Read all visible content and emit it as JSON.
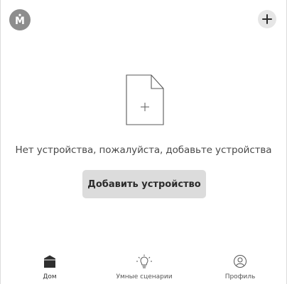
{
  "header": {
    "avatar_letter": "M",
    "avatar_icon": "user-avatar",
    "add_icon": "plus-icon"
  },
  "empty_state": {
    "icon": "file-plus-icon",
    "message": "Нет устройства, пожалуйста, добавьте устройства",
    "button_label": "Добавить устройство"
  },
  "bottom_nav": {
    "items": [
      {
        "label": "Дом",
        "icon": "home-icon",
        "active": true
      },
      {
        "label": "Умные сценарии",
        "icon": "lightbulb-icon",
        "active": false
      },
      {
        "label": "Профиль",
        "icon": "profile-icon",
        "active": false
      }
    ]
  },
  "colors": {
    "avatar_bg": "#8d8d8d",
    "button_bg": "#dcdcdc",
    "text": "#4a4a4a",
    "icon": "#3a3a3a"
  }
}
